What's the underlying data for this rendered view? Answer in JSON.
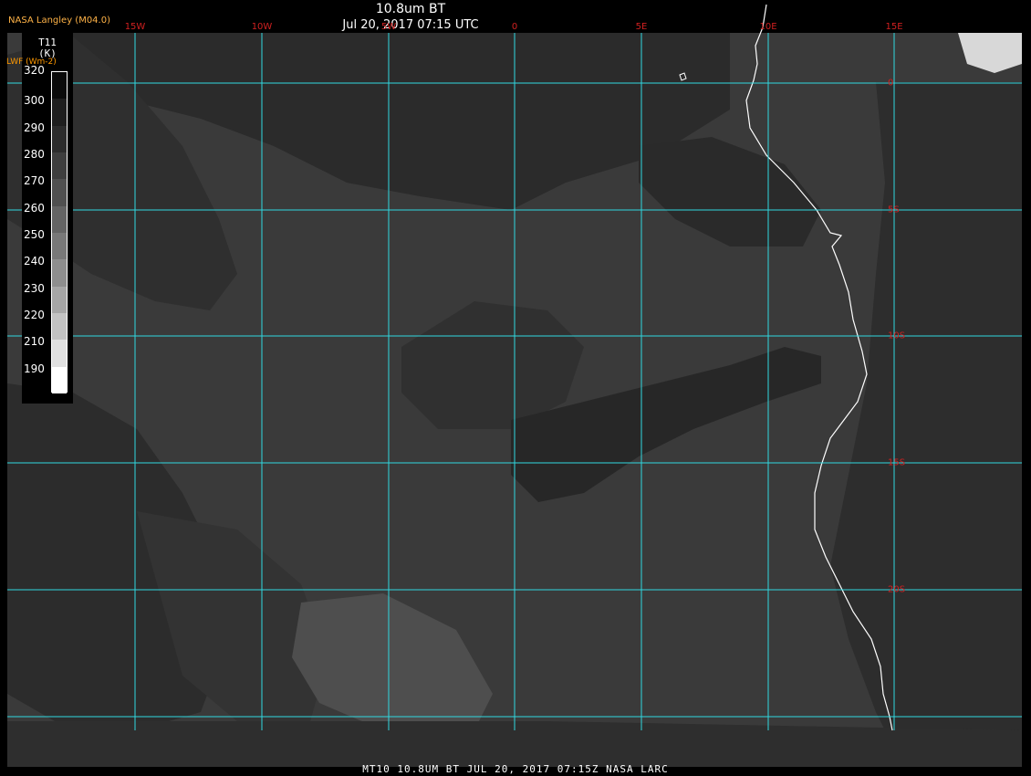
{
  "header": {
    "title": "10.8um BT",
    "subtitle": "Jul 20, 2017 07:15 UTC",
    "credit": "NASA Langley (M04.0)"
  },
  "legend": {
    "title_line1": "T11",
    "title_line2": "(K)",
    "unit_label": "LWF (Wm-2)",
    "ticks": [
      "320",
      "300",
      "290",
      "280",
      "270",
      "260",
      "250",
      "240",
      "230",
      "220",
      "210",
      "190"
    ],
    "colors": {
      "320": "#0a0a0a",
      "300": "#1e1e1e",
      "290": "#2c2c2c",
      "280": "#3e3e3e",
      "270": "#505050",
      "260": "#646464",
      "250": "#787878",
      "240": "#8e8e8e",
      "230": "#a6a6a6",
      "220": "#c2c2c2",
      "210": "#e0e0e0",
      "190": "#ffffff"
    }
  },
  "grid": {
    "longitudes": [
      "15W",
      "10W",
      "5W",
      "0",
      "5E",
      "10E",
      "15E"
    ],
    "latitudes": [
      "0",
      "5S",
      "10S",
      "15S",
      "20S"
    ],
    "line_color": "#30d8e0",
    "label_color": "#d02020",
    "coast_color": "#ffffff"
  },
  "colors": {
    "ocean": "#3a3a3a",
    "cloud_dark": "#2a2a2a",
    "cloud_light": "#4e4e4e",
    "bright_cloud": "#d8d8d8"
  },
  "footer": {
    "caption": "MT10  10.8UM BT   JUL 20, 2017 07:15Z   NASA LARC"
  }
}
